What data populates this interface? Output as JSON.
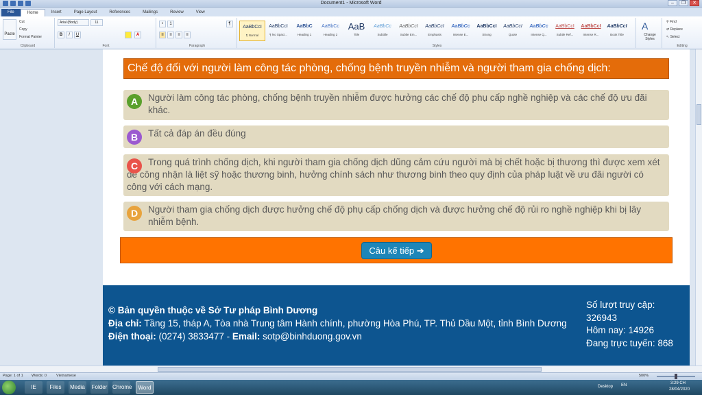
{
  "window": {
    "title": "Document1 - Microsoft Word",
    "controls": [
      "–",
      "❐",
      "✕"
    ]
  },
  "ribbon": {
    "tabs": [
      "File",
      "Home",
      "Insert",
      "Page Layout",
      "References",
      "Mailings",
      "Review",
      "View"
    ],
    "active_tab": "Home",
    "clipboard": {
      "paste": "Paste",
      "cut": "Cut",
      "copy": "Copy",
      "format_painter": "Format Painter",
      "label": "Clipboard"
    },
    "font": {
      "name": "Arial (Body)",
      "size": "11",
      "label": "Font",
      "bold": "B",
      "italic": "I",
      "underline": "U"
    },
    "paragraph": {
      "label": "Paragraph"
    },
    "styles": {
      "label": "Styles",
      "items": [
        {
          "sample": "AaBbCcI",
          "name": "¶ Normal"
        },
        {
          "sample": "AaBbCcI",
          "name": "¶ No Spaci..."
        },
        {
          "sample": "AaBbC",
          "name": "Heading 1"
        },
        {
          "sample": "AaBbCc",
          "name": "Heading 2"
        },
        {
          "sample": "AaB",
          "name": "Title"
        },
        {
          "sample": "AaBbCc",
          "name": "Subtitle"
        },
        {
          "sample": "AaBbCcI",
          "name": "Subtle Em..."
        },
        {
          "sample": "AaBbCcI",
          "name": "Emphasis"
        },
        {
          "sample": "AaBbCc",
          "name": "Intense E..."
        },
        {
          "sample": "AaBbCcI",
          "name": "Strong"
        },
        {
          "sample": "AaBbCcI",
          "name": "Quote"
        },
        {
          "sample": "AaBbCc",
          "name": "Intense Q..."
        },
        {
          "sample": "AaBbCcI",
          "name": "Subtle Ref..."
        },
        {
          "sample": "AaBbCcI",
          "name": "Intense R..."
        },
        {
          "sample": "AaBbCcI",
          "name": "Book Title"
        }
      ],
      "change_styles": "Change Styles"
    },
    "editing": {
      "find": "Find",
      "replace": "Replace",
      "select": "Select",
      "label": "Editing"
    }
  },
  "quiz": {
    "question": "Chế độ đối với người làm công tác phòng, chống bệnh truyền nhiễm và người tham gia chống dịch:",
    "answers": [
      {
        "letter": "A",
        "color": "#5aa02c",
        "text": "Người làm công tác phòng, chống bệnh truyền nhiễm được hưởng các chế độ phụ cấp nghề nghiệp và các chế độ ưu đãi khác."
      },
      {
        "letter": "B",
        "color": "#9b59d0",
        "text": "Tất cả đáp án đều đúng"
      },
      {
        "letter": "C",
        "color": "#e9534a",
        "text": "Trong quá trình chống dịch, khi người tham gia chống dịch dũng cảm cứu người mà bị chết hoặc bị thương thì được xem xét để công nhận là liệt sỹ hoặc thương binh, hưởng chính sách như thương binh theo quy định của pháp luật về ưu đãi người có công với cách mạng."
      },
      {
        "letter": "D",
        "color": "#e8a33d",
        "text": "Người tham gia chống dịch được hưởng chế độ phụ cấp chống dịch và được hưởng chế độ rủi ro nghề nghiệp khi bị lây nhiễm bệnh."
      }
    ],
    "next_button": "Câu kế tiếp ➔"
  },
  "footer": {
    "copyright": "© Bản quyền thuộc về Sở Tư pháp Bình Dương",
    "address_label": "Địa chỉ:",
    "address": " Tầng 15, tháp A, Tòa nhà Trung tâm Hành chính, phường Hòa Phú, TP. Thủ Dầu Một, tỉnh Bình Dương",
    "phone_label": "Điện thoại:",
    "phone": " (0274) 3833477 - ",
    "email_label": "Email:",
    "email": " sotp@binhduong.gov.vn",
    "visits_label": "Số lượt truy cập:",
    "visits": "326943",
    "today": "Hôm nay: 14926",
    "online": "Đang trực tuyến: 868"
  },
  "statusbar": {
    "page": "Page: 1 of 1",
    "words": "Words: 0",
    "language": "Vietnamese",
    "zoom": "500%"
  },
  "taskbar": {
    "apps": [
      "IE",
      "Files",
      "Media",
      "Folder",
      "Chrome",
      "Word"
    ],
    "desktop": "Desktop",
    "lang": "EN",
    "time": "3:29 CH",
    "date": "28/04/2020"
  }
}
